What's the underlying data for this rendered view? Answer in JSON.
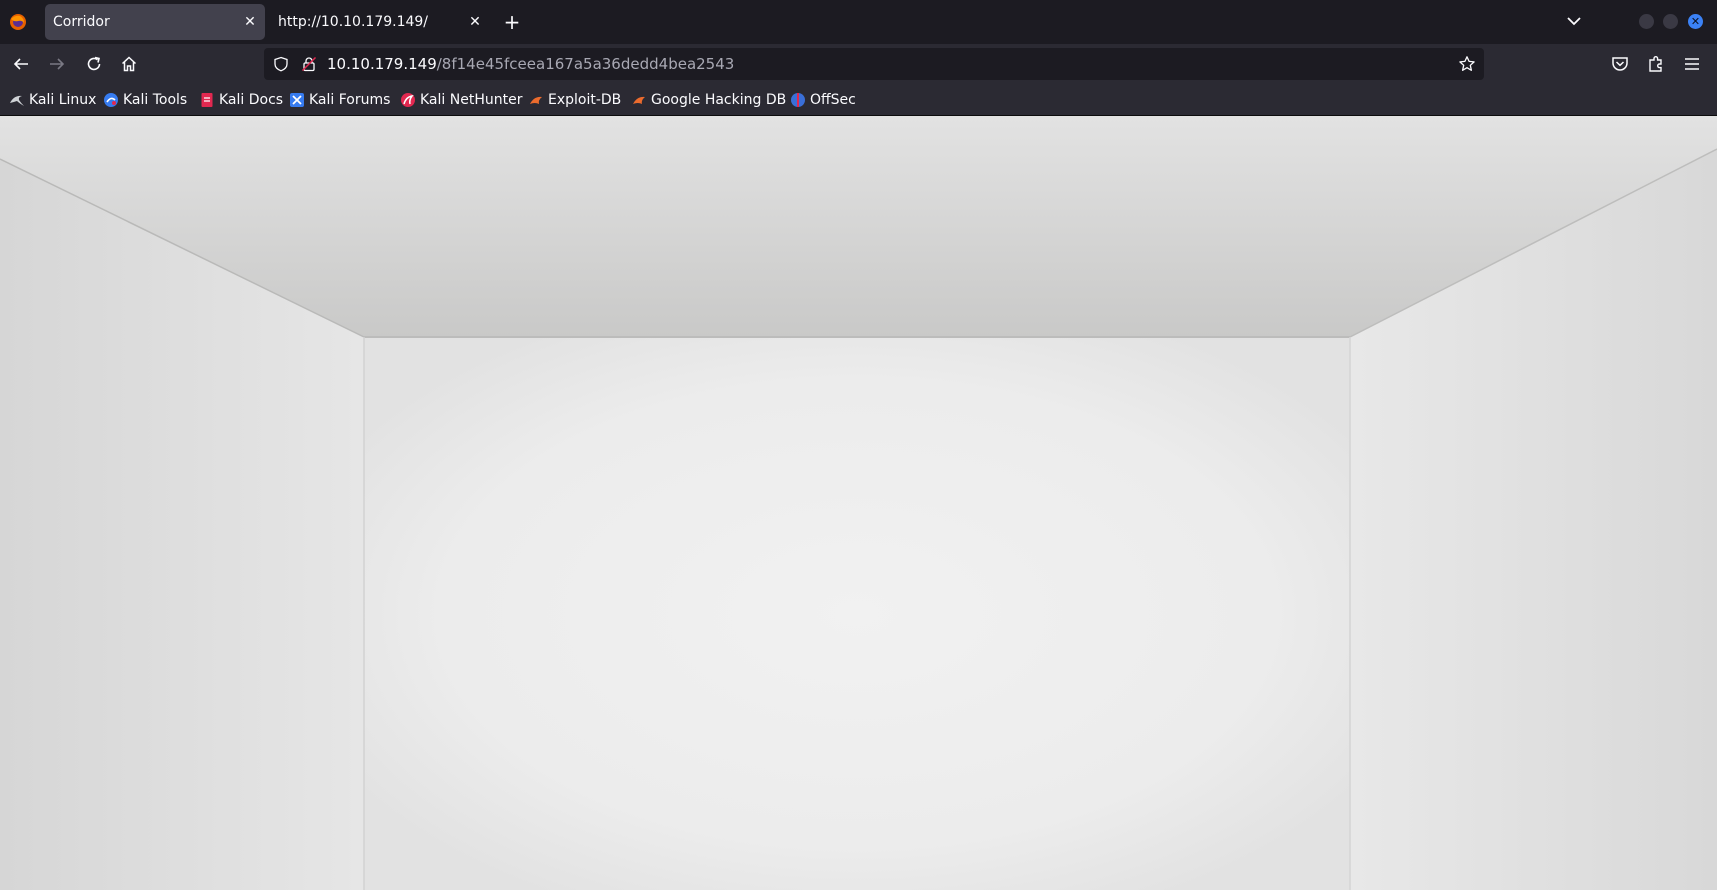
{
  "tabs": [
    {
      "title": "Corridor",
      "active": true
    },
    {
      "title": "http://10.10.179.149/",
      "active": false
    }
  ],
  "address_bar": {
    "host": "10.10.179.149",
    "path": "/8f14e45fceea167a5a36dedd4bea2543"
  },
  "bookmarks": [
    {
      "label": "Kali Linux",
      "icon": "kali-dragon-icon"
    },
    {
      "label": "Kali Tools",
      "icon": "kali-tools-icon"
    },
    {
      "label": "Kali Docs",
      "icon": "kali-docs-icon"
    },
    {
      "label": "Kali Forums",
      "icon": "kali-forums-icon"
    },
    {
      "label": "Kali NetHunter",
      "icon": "nethunter-icon"
    },
    {
      "label": "Exploit-DB",
      "icon": "exploit-db-icon"
    },
    {
      "label": "Google Hacking DB",
      "icon": "ghdb-icon"
    },
    {
      "label": "OffSec",
      "icon": "offsec-icon"
    }
  ],
  "colors": {
    "chrome_dark": "#1c1b22",
    "toolbar": "#2b2a33",
    "active_tab": "#42414d",
    "close_accent": "#3b82f6"
  }
}
